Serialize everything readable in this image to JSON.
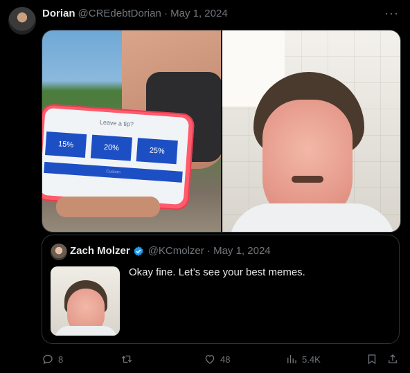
{
  "tweet": {
    "author_name": "Dorian",
    "handle_and_date": "@CREdebtDorian · May 1, 2024",
    "more_label": "···",
    "media": {
      "tip_title": "Leave a tip?",
      "tip_options": [
        "15%",
        "20%",
        "25%"
      ],
      "tip_bar": "Custom"
    },
    "quote": {
      "author_name": "Zach Molzer",
      "handle_and_date": "@KCmolzer · May 1, 2024",
      "text": "Okay fine. Let’s see your best memes.",
      "verified_color": "#1d9bf0"
    },
    "actions": {
      "replies": "8",
      "retweets": "",
      "likes": "48",
      "views": "5.4K"
    }
  }
}
